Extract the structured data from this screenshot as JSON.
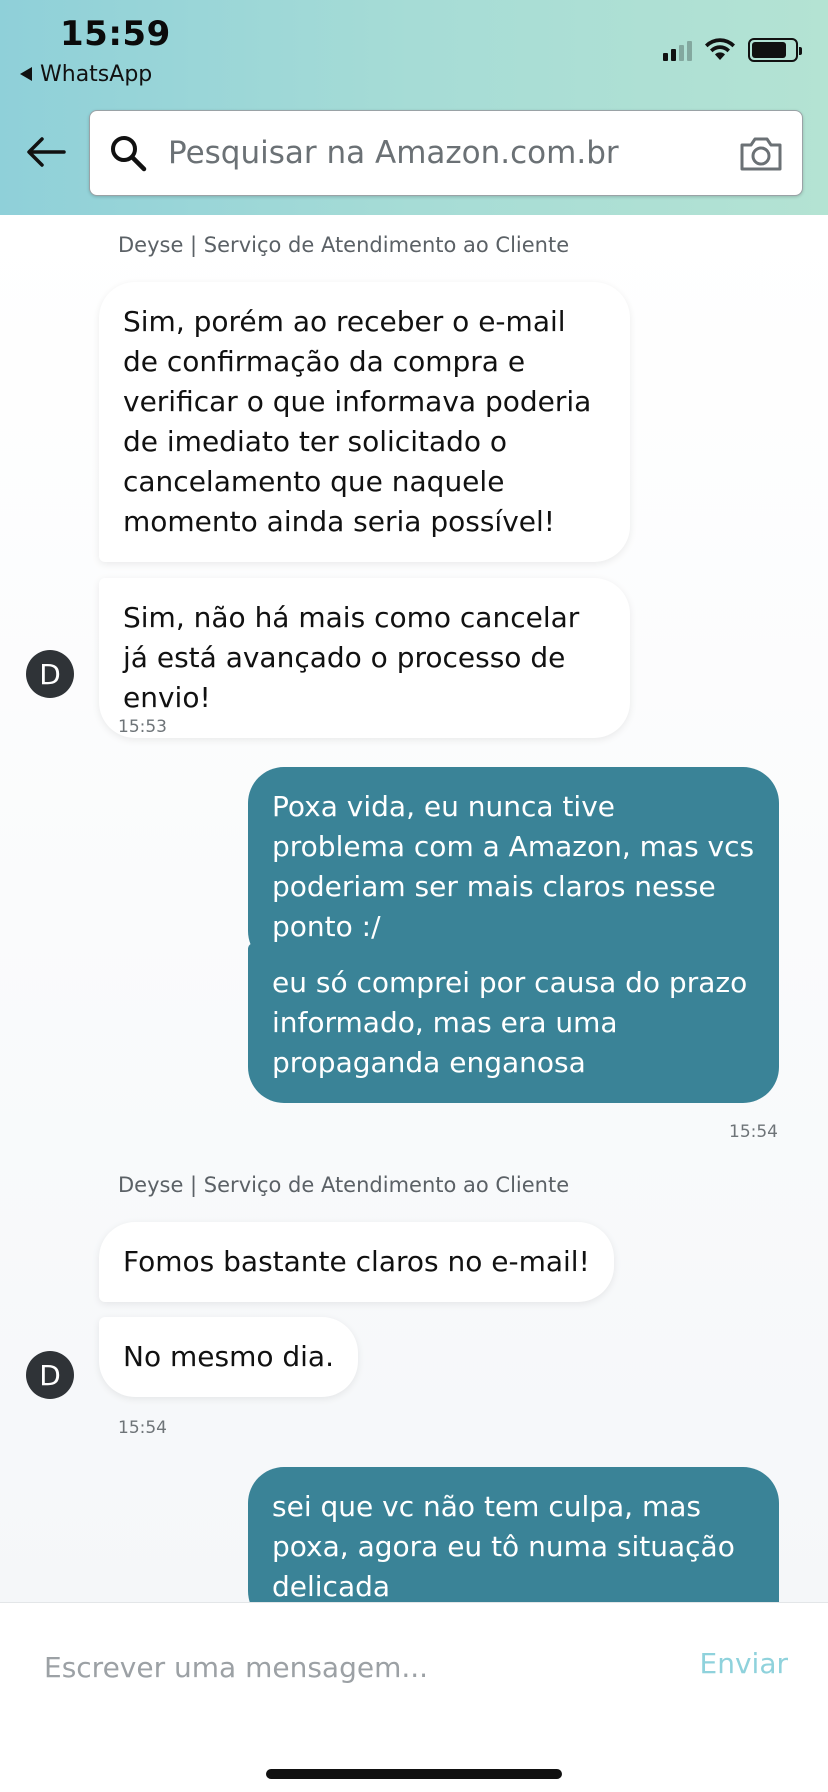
{
  "status_bar": {
    "time": "15:59",
    "back_app": "WhatsApp",
    "signal_icon": "cellular-signal-icon",
    "wifi_icon": "wifi-icon",
    "battery_icon": "battery-icon"
  },
  "header": {
    "back_icon": "arrow-left-icon",
    "search_placeholder": "Pesquisar na Amazon.com.br",
    "search_icon": "search-icon",
    "camera_icon": "camera-icon"
  },
  "chat": {
    "group1": {
      "agent": "Deyse | Serviço de Atendimento ao Cliente",
      "msg1": "Sim, porém ao receber o e-mail de confirmação da compra e verificar o que informava poderia de imediato ter solicitado o cancelamento que naquele momento ainda seria possível!",
      "msg2": "Sim, não há mais como cancelar já está avançado o processo de envio!",
      "avatar": "D",
      "time": "15:53"
    },
    "group2": {
      "msg1": "Poxa vida, eu nunca tive problema com a Amazon, mas vcs poderiam ser mais claros nesse ponto :/",
      "msg2": "eu só comprei por causa do prazo informado, mas era uma propaganda enganosa",
      "time": "15:54"
    },
    "group3": {
      "agent": "Deyse | Serviço de Atendimento ao Cliente",
      "msg1": "Fomos bastante claros no e-mail!",
      "msg2": "No mesmo dia.",
      "avatar": "D",
      "time": "15:54"
    },
    "group4": {
      "msg1": "sei que vc não tem culpa, mas poxa, agora eu tô numa situação delicada"
    }
  },
  "composer": {
    "placeholder": "Escrever uma mensagem...",
    "send_label": "Enviar"
  },
  "colors": {
    "header_gradient_start": "#8fd0d9",
    "header_gradient_end": "#b4e3d3",
    "outgoing_bubble": "#3a8397",
    "send_button": "#8fd2dc",
    "avatar_bg": "#2f3337"
  }
}
